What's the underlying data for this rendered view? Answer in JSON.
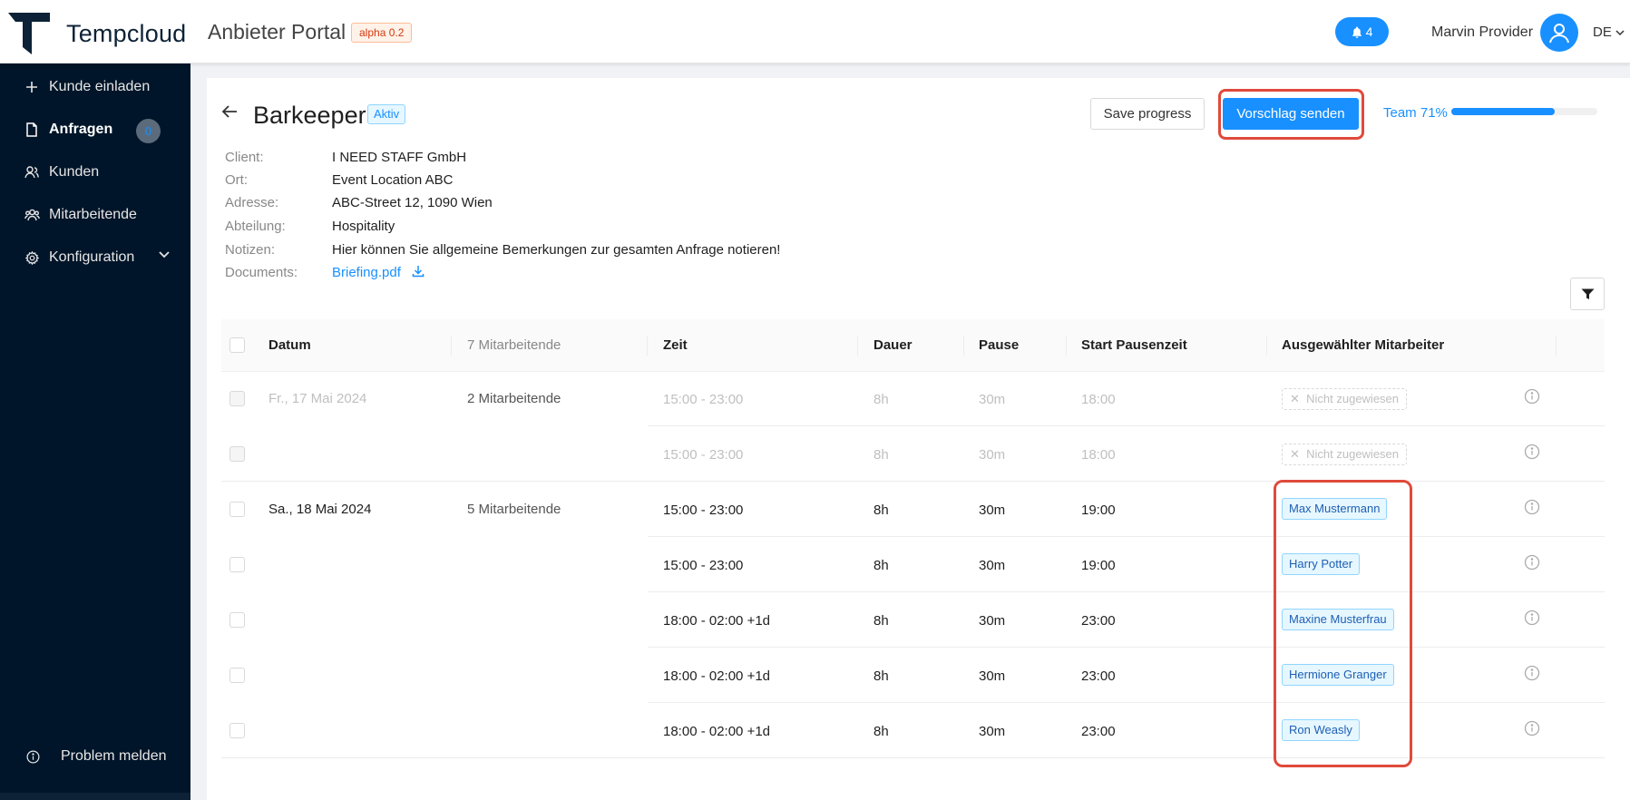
{
  "header": {
    "brand": "Tempcloud",
    "portal": "Anbieter Portal",
    "version": "alpha 0.2",
    "notifications": "4",
    "user": "Marvin Provider",
    "language": "DE"
  },
  "sidebar": {
    "items": [
      {
        "label": "Kunde einladen",
        "icon": "plus-icon"
      },
      {
        "label": "Anfragen",
        "icon": "document-icon",
        "badge": "0"
      },
      {
        "label": "Kunden",
        "icon": "customers-icon"
      },
      {
        "label": "Mitarbeitende",
        "icon": "employees-icon"
      },
      {
        "label": "Konfiguration",
        "icon": "gear-icon"
      }
    ],
    "report": "Problem melden"
  },
  "page": {
    "title": "Barkeeper",
    "status": "Aktiv",
    "save_label": "Save progress",
    "send_label": "Vorschlag senden",
    "team_label": "Team 71%",
    "team_progress": 0.71,
    "info": {
      "client_label": "Client:",
      "client": "I NEED STAFF GmbH",
      "ort_label": "Ort:",
      "ort": "Event Location ABC",
      "adresse_label": "Adresse:",
      "adresse": "ABC-Street 12, 1090 Wien",
      "abteilung_label": "Abteilung:",
      "abteilung": "Hospitality",
      "notizen_label": "Notizen:",
      "notizen": "Hier können Sie allgemeine Bemerkungen zur gesamten Anfrage notieren!",
      "documents_label": "Documents:",
      "document": "Briefing.pdf"
    }
  },
  "table": {
    "headers": {
      "datum": "Datum",
      "mitarbeitende": "7 Mitarbeitende",
      "zeit": "Zeit",
      "dauer": "Dauer",
      "pause": "Pause",
      "start_pause": "Start Pausenzeit",
      "mitarbeiter": "Ausgewählter Mitarbeiter"
    },
    "groups": [
      {
        "date": "Fr., 17 Mai 2024",
        "count": "2 Mitarbeitende"
      },
      {
        "date": "Sa., 18 Mai 2024",
        "count": "5 Mitarbeitende"
      }
    ],
    "rows": [
      {
        "zeit": "15:00 - 23:00",
        "dauer": "8h",
        "pause": "30m",
        "start": "18:00",
        "employee": "Nicht zugewiesen",
        "assigned": false
      },
      {
        "zeit": "15:00 - 23:00",
        "dauer": "8h",
        "pause": "30m",
        "start": "18:00",
        "employee": "Nicht zugewiesen",
        "assigned": false
      },
      {
        "zeit": "15:00 - 23:00",
        "dauer": "8h",
        "pause": "30m",
        "start": "19:00",
        "employee": "Max Mustermann",
        "assigned": true
      },
      {
        "zeit": "15:00 - 23:00",
        "dauer": "8h",
        "pause": "30m",
        "start": "19:00",
        "employee": "Harry Potter",
        "assigned": true
      },
      {
        "zeit": "18:00 - 02:00 +1d",
        "dauer": "8h",
        "pause": "30m",
        "start": "23:00",
        "employee": "Maxine Musterfrau",
        "assigned": true
      },
      {
        "zeit": "18:00 - 02:00 +1d",
        "dauer": "8h",
        "pause": "30m",
        "start": "23:00",
        "employee": "Hermione Granger",
        "assigned": true
      },
      {
        "zeit": "18:00 - 02:00 +1d",
        "dauer": "8h",
        "pause": "30m",
        "start": "23:00",
        "employee": "Ron Weasly",
        "assigned": true
      }
    ]
  }
}
